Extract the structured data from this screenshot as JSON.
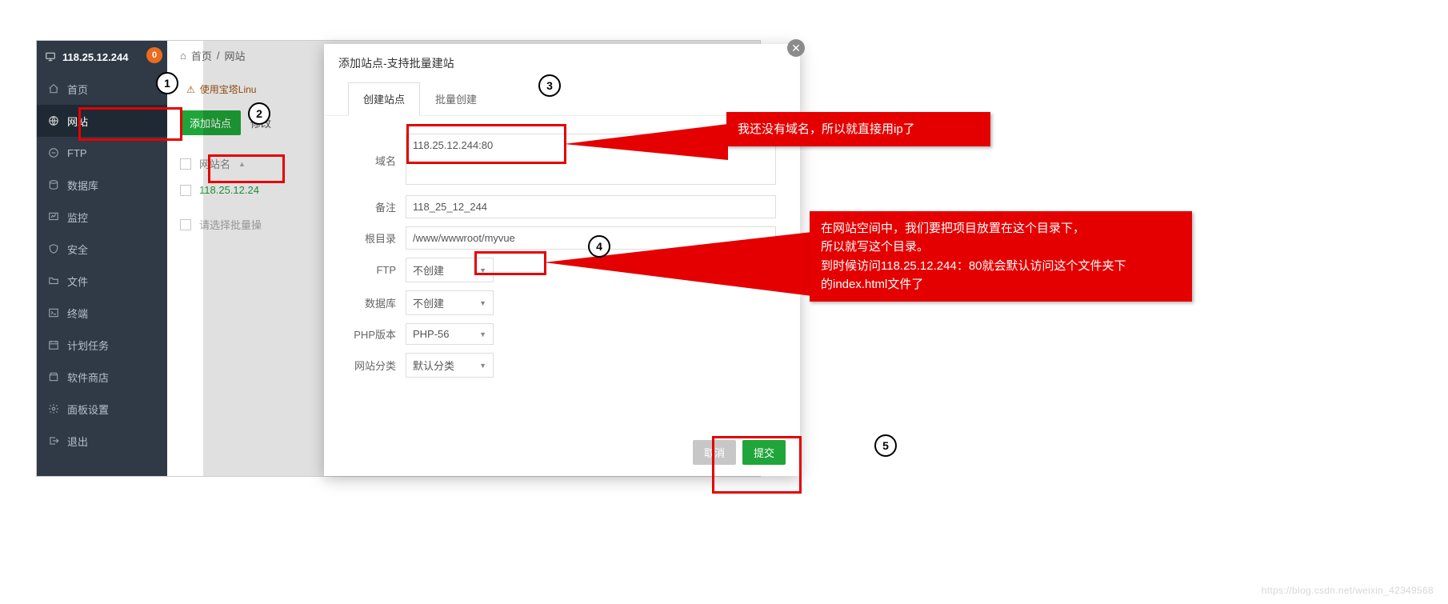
{
  "header": {
    "ip": "118.25.12.244",
    "badge": "0"
  },
  "sidebar": {
    "items": [
      {
        "label": "首页",
        "icon": "home-icon"
      },
      {
        "label": "网站",
        "icon": "globe-icon",
        "active": true
      },
      {
        "label": "FTP",
        "icon": "ftp-icon"
      },
      {
        "label": "数据库",
        "icon": "database-icon"
      },
      {
        "label": "监控",
        "icon": "monitor-icon"
      },
      {
        "label": "安全",
        "icon": "shield-icon"
      },
      {
        "label": "文件",
        "icon": "folder-icon"
      },
      {
        "label": "终端",
        "icon": "terminal-icon"
      },
      {
        "label": "计划任务",
        "icon": "schedule-icon"
      },
      {
        "label": "软件商店",
        "icon": "store-icon"
      },
      {
        "label": "面板设置",
        "icon": "gear-icon"
      },
      {
        "label": "退出",
        "icon": "exit-icon"
      }
    ]
  },
  "breadcrumb": {
    "home_icon": "⌂",
    "home": "首页",
    "sep": "/",
    "current": "网站"
  },
  "warn": {
    "text": "使用宝塔Linu"
  },
  "buttons": {
    "add_site": "添加站点",
    "modify": "修改"
  },
  "table": {
    "col_sitename": "网站名",
    "sort_indicator": "▲",
    "row_site": "118.25.12.24",
    "batch_placeholder": "请选择批量操"
  },
  "modal": {
    "title": "添加站点-支持批量建站",
    "tabs": {
      "create": "创建站点",
      "batch": "批量创建"
    },
    "labels": {
      "domain": "域名",
      "remark": "备注",
      "root": "根目录",
      "ftp": "FTP",
      "db": "数据库",
      "php": "PHP版本",
      "cat": "网站分类"
    },
    "values": {
      "domain": "118.25.12.244:80",
      "remark": "118_25_12_244",
      "root": "/www/wwwroot/myvue",
      "ftp": "不创建",
      "db": "不创建",
      "php": "PHP-56",
      "cat": "默认分类"
    },
    "footer": {
      "cancel": "取消",
      "submit": "提交"
    }
  },
  "annotations": {
    "m1": "1",
    "m2": "2",
    "m3": "3",
    "m4": "4",
    "m5": "5",
    "callout1": "我还没有域名，所以就直接用ip了",
    "callout2_l1": "在网站空间中，我们要把项目放置在这个目录下，",
    "callout2_l2": "所以就写这个目录。",
    "callout2_l3": "到时候访问118.25.12.244：80就会默认访问这个文件夹下",
    "callout2_l4": "的index.html文件了"
  },
  "watermark": "https://blog.csdn.net/weixin_42349568"
}
